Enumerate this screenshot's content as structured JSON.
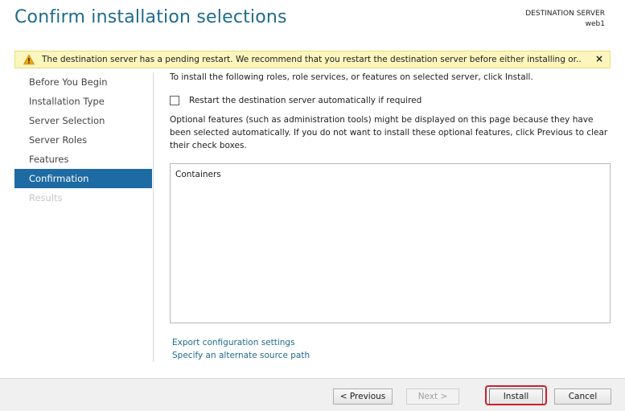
{
  "header": {
    "title": "Confirm installation selections",
    "destination_label": "DESTINATION SERVER",
    "destination_server": "web1"
  },
  "warning": {
    "icon": "warning-icon",
    "text": "The destination server has a pending restart. We recommend that you restart the destination server before either installing or...",
    "close_label": "×",
    "colors": {
      "background": "#fcf6bd",
      "icon": "#e8a317"
    }
  },
  "sidebar": {
    "items": [
      {
        "label": "Before You Begin",
        "state": "normal"
      },
      {
        "label": "Installation Type",
        "state": "normal"
      },
      {
        "label": "Server Selection",
        "state": "normal"
      },
      {
        "label": "Server Roles",
        "state": "normal"
      },
      {
        "label": "Features",
        "state": "normal"
      },
      {
        "label": "Confirmation",
        "state": "active"
      },
      {
        "label": "Results",
        "state": "disabled"
      }
    ]
  },
  "main": {
    "intro": "To install the following roles, role services, or features on selected server, click Install.",
    "restart_checkbox": {
      "label": "Restart the destination server automatically if required",
      "checked": false
    },
    "note": "Optional features (such as administration tools) might be displayed on this page because they have been selected automatically. If you do not want to install these optional features, click Previous to clear their check boxes.",
    "selections": [
      "Containers"
    ],
    "links": {
      "export": "Export configuration settings",
      "alternate_source": "Specify an alternate source path"
    }
  },
  "footer": {
    "previous": "< Previous",
    "next": "Next >",
    "install": "Install",
    "cancel": "Cancel"
  },
  "colors": {
    "accent": "#1e6b8c",
    "nav_active": "#1e6ba3",
    "highlight_ring": "#cc1f2d"
  }
}
